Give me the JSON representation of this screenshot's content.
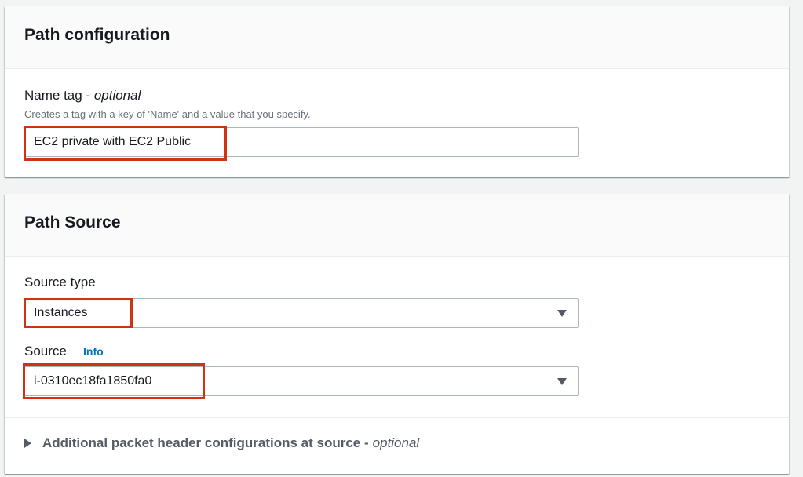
{
  "path_configuration": {
    "title": "Path configuration",
    "name_tag": {
      "label": "Name tag - ",
      "label_suffix": "optional",
      "description": "Creates a tag with a key of 'Name' and a value that you specify.",
      "value": "EC2 private with EC2 Public"
    }
  },
  "path_source": {
    "title": "Path Source",
    "source_type": {
      "label": "Source type",
      "selected": "Instances"
    },
    "source": {
      "label": "Source",
      "info": "Info",
      "selected": "i-0310ec18fa1850fa0"
    },
    "additional": {
      "label": "Additional packet header configurations at source - ",
      "label_suffix": "optional"
    }
  },
  "colors": {
    "highlight": "#d13212",
    "link": "#0073bb"
  }
}
